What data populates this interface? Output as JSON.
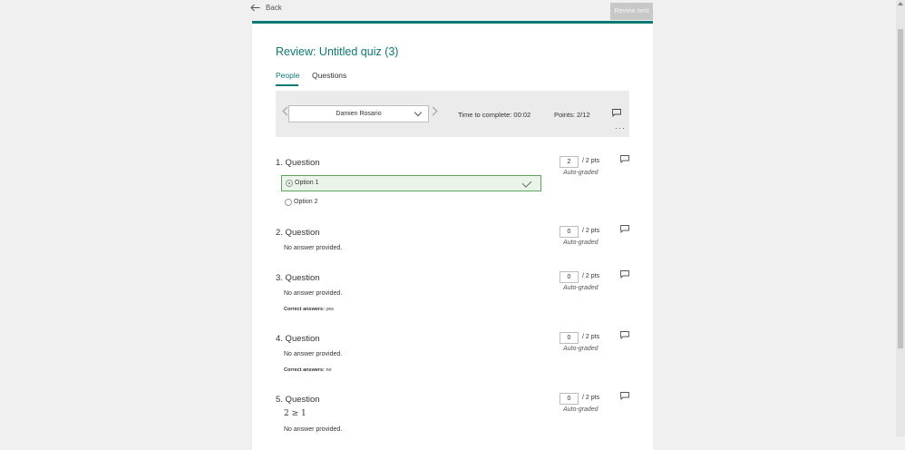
{
  "topbar": {
    "back_label": "Back",
    "review_next_label": "Review next"
  },
  "form": {
    "title": "Review: Untitled quiz (3)",
    "tabs": [
      {
        "label": "People",
        "active": true
      },
      {
        "label": "Questions",
        "active": false
      }
    ]
  },
  "respondent": {
    "name": "Damien Rosario",
    "time_to_complete": "Time to complete: 00:02",
    "points": "Points: 2/12"
  },
  "questions": [
    {
      "title": "1. Question",
      "score": "2",
      "total": "/ 2 pts",
      "grading": "Auto-graded",
      "options": [
        {
          "label": "Option 1",
          "selected": true,
          "correct": true
        },
        {
          "label": "Option 2",
          "selected": false
        }
      ]
    },
    {
      "title": "2. Question",
      "score": "0",
      "total": "/ 2 pts",
      "grading": "Auto-graded",
      "answer": "No answer provided."
    },
    {
      "title": "3. Question",
      "score": "0",
      "total": "/ 2 pts",
      "grading": "Auto-graded",
      "answer": "No answer provided.",
      "correct_label": "Correct answers:",
      "correct_value": "yes"
    },
    {
      "title": "4. Question",
      "score": "0",
      "total": "/ 2 pts",
      "grading": "Auto-graded",
      "answer": "No answer provided.",
      "correct_label": "Correct answers:",
      "correct_value": "no"
    },
    {
      "title": "5. Question",
      "score": "0",
      "total": "/ 2 pts",
      "grading": "Auto-graded",
      "math": "2 ≥ 1",
      "answer": "No answer provided."
    }
  ],
  "colors": {
    "accent": "#0b7a75",
    "correct_border": "#5fa35f",
    "correct_fill": "#eaf4e8"
  },
  "icons": {
    "back": "arrow-left-icon",
    "comment": "comment-icon",
    "more": "more-icon",
    "check": "check-icon"
  }
}
